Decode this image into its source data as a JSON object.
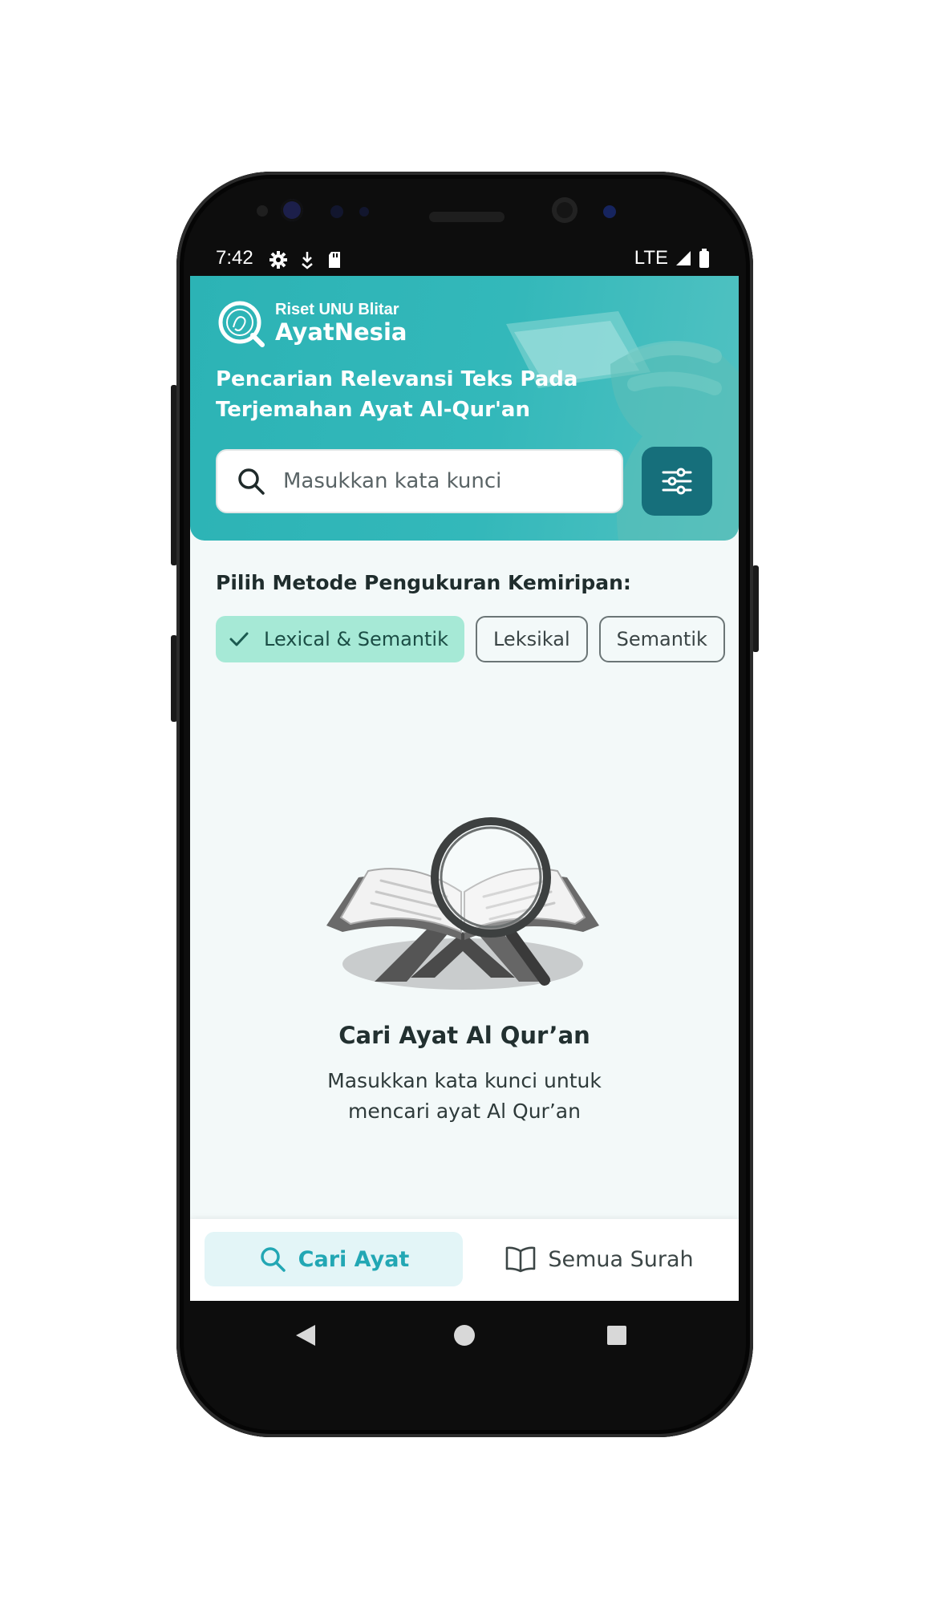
{
  "status_bar": {
    "time": "7:42",
    "network": "LTE"
  },
  "header": {
    "org": "Riset UNU Blitar",
    "app_name": "AyatNesia",
    "headline": "Pencarian Relevansi Teks Pada Terjemahan Ayat Al-Qur'an"
  },
  "search": {
    "placeholder": "Masukkan kata kunci",
    "value": ""
  },
  "method": {
    "label": "Pilih Metode Pengukuran Kemiripan:",
    "options": [
      "Lexical & Semantik",
      "Leksikal",
      "Semantik"
    ],
    "selected": "Lexical & Semantik"
  },
  "empty_state": {
    "title": "Cari Ayat Al Qur’an",
    "description": "Masukkan kata kunci untuk mencari ayat Al Qur’an"
  },
  "bottom_nav": {
    "items": [
      {
        "label": "Cari Ayat",
        "icon": "search-icon",
        "active": true
      },
      {
        "label": "Semua Surah",
        "icon": "book-icon",
        "active": false
      }
    ]
  },
  "colors": {
    "primary": "#2cb3b5",
    "filter_button": "#166f7b",
    "chip_active": "#a6e9d6",
    "nav_active_bg": "#e3f5f7",
    "nav_active_text": "#22a7b4"
  }
}
